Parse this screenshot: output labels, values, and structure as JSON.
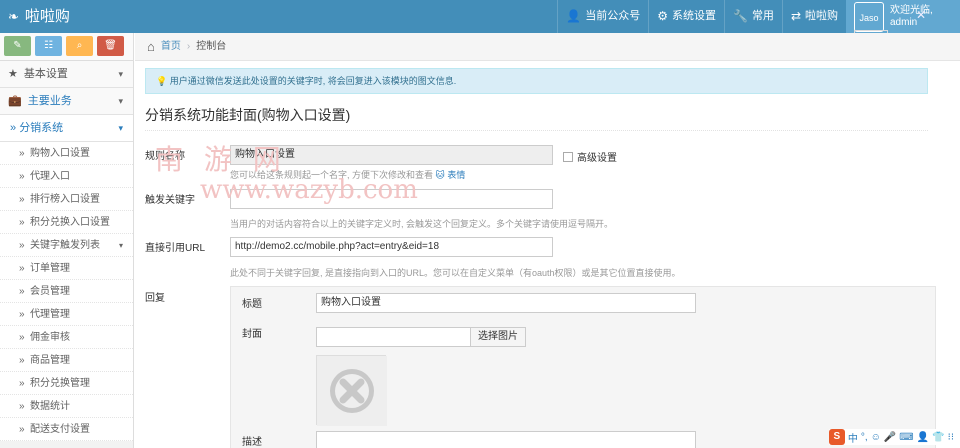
{
  "topbar": {
    "brand": "啦啦购",
    "brand_icon": "leaf-icon",
    "nav": [
      {
        "label": "当前公众号",
        "icon": "user-icon"
      },
      {
        "label": "系统设置",
        "icon": "gear-icon"
      },
      {
        "label": "常用",
        "icon": "wrench-icon"
      },
      {
        "label": "啦啦购",
        "icon": "exchange-icon"
      }
    ],
    "user": {
      "avatar_alt": "Jaso",
      "greeting": "欢迎光临,",
      "name": "admin"
    },
    "colors": {
      "bar": "#438eb9",
      "user_box": "#62a8d1"
    }
  },
  "sidebar": {
    "shortcuts": [
      {
        "icon": "pencil-icon",
        "glyph": "✎"
      },
      {
        "icon": "grid-icon",
        "glyph": "☷"
      },
      {
        "icon": "search-icon",
        "glyph": "⌕"
      },
      {
        "icon": "trash-icon",
        "glyph": "🗑"
      }
    ],
    "level1": [
      {
        "label": "基本设置",
        "icon": "star-icon"
      },
      {
        "label": "主要业务",
        "icon": "briefcase-icon"
      }
    ],
    "active_group": "分销系统",
    "items": [
      {
        "label": "购物入口设置"
      },
      {
        "label": "代理入口"
      },
      {
        "label": "排行榜入口设置"
      },
      {
        "label": "积分兑换入口设置"
      },
      {
        "label": "关键字触发列表"
      },
      {
        "label": "订单管理"
      },
      {
        "label": "会员管理"
      },
      {
        "label": "代理管理"
      },
      {
        "label": "佣金审核"
      },
      {
        "label": "商品管理"
      },
      {
        "label": "积分兑换管理"
      },
      {
        "label": "数据统计"
      },
      {
        "label": "配送支付设置"
      }
    ]
  },
  "breadcrumbs": {
    "home": "首页",
    "current": "控制台"
  },
  "alert": "用户通过微信发送此处设置的关键字时, 将会回复进入该模块的图文信息.",
  "page_title": "分销系统功能封面(购物入口设置)",
  "form": {
    "rule_name": {
      "label": "规则名称",
      "value": "购物入口设置",
      "advanced_label": "高级设置",
      "help": "您可以给这条规则起一个名字, 方便下次修改和查看",
      "emoji_link": "表情"
    },
    "keyword": {
      "label": "触发关键字",
      "value": "",
      "help": "当用户的对话内容符合以上的关键字定义时, 会触发这个回复定义。多个关键字请使用逗号隔开。"
    },
    "url": {
      "label": "直接引用URL",
      "value": "http://demo2.cc/mobile.php?act=entry&eid=18",
      "help": "此处不同于关键字回复, 是直接指向到入口的URL。您可以在自定义菜单（有oauth权限）或是其它位置直接使用。"
    },
    "reply": {
      "label": "回复",
      "title_label": "标题",
      "title_value": "购物入口设置",
      "cover_label": "封面",
      "cover_value": "",
      "pick_button": "选择图片",
      "desc_label": "描述"
    }
  },
  "watermark": {
    "cn": "南 游 网",
    "url": "www.wazyb.com"
  },
  "ime": {
    "logo": "S",
    "items": [
      "中",
      "°,",
      "☺",
      "🎤",
      "⌨",
      "👤",
      "👕",
      "⁝⁝"
    ]
  }
}
